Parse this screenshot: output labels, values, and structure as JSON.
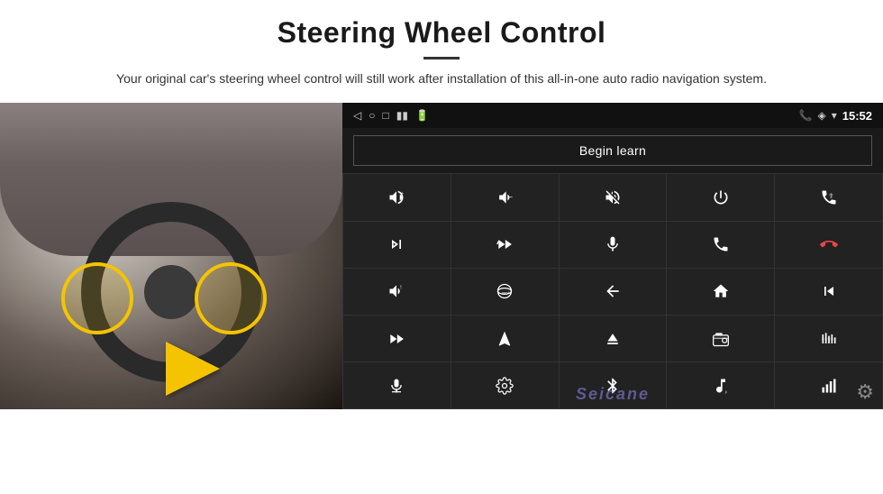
{
  "header": {
    "title": "Steering Wheel Control",
    "subtitle": "Your original car's steering wheel control will still work after installation of this all-in-one auto radio navigation system."
  },
  "status_bar": {
    "time": "15:52",
    "icons": [
      "back-arrow",
      "home-circle",
      "square",
      "signal",
      "battery",
      "phone",
      "location",
      "wifi"
    ]
  },
  "begin_learn": {
    "label": "Begin learn"
  },
  "controls": {
    "rows": [
      [
        "vol-up",
        "vol-down",
        "mute",
        "power",
        "phone-prev"
      ],
      [
        "next-track",
        "seek-fwd",
        "mic",
        "phone-call",
        "phone-hang"
      ],
      [
        "horn",
        "360-cam",
        "back",
        "home",
        "prev-track"
      ],
      [
        "fast-fwd",
        "navigate",
        "eject",
        "radio",
        "eq"
      ],
      [
        "mic2",
        "settings2",
        "bluetooth",
        "music",
        "volume-bars"
      ]
    ]
  },
  "watermark": "Seicane",
  "colors": {
    "background": "#1a1a1a",
    "btn_bg": "#222222",
    "border": "#333333",
    "accent": "#f5c400",
    "text": "#ffffff",
    "statusbar": "#111111"
  }
}
